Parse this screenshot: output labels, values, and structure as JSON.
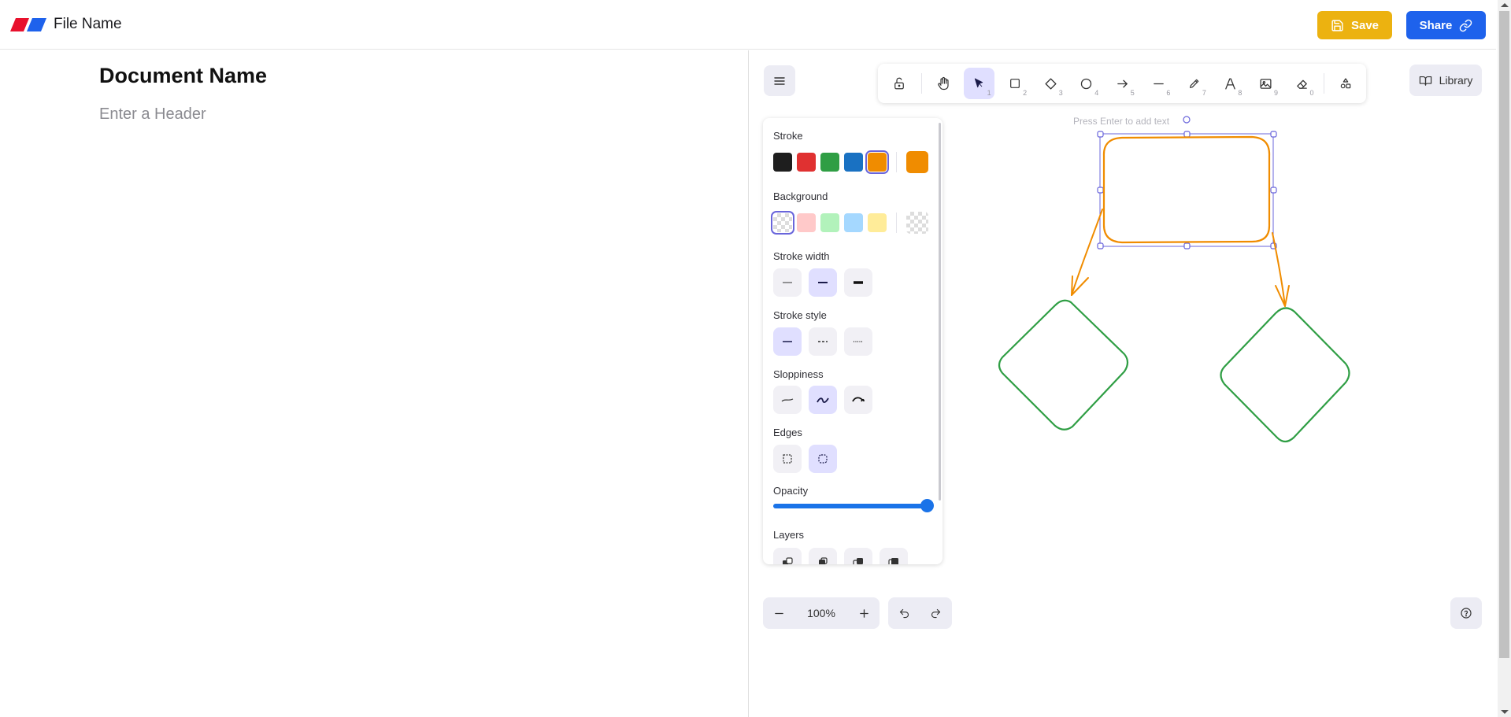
{
  "header": {
    "file_name": "File Name",
    "save_label": "Save",
    "share_label": "Share",
    "brand_colors": [
      "#e8112d",
      "#1e62ec"
    ],
    "save_color": "#ecb210",
    "share_color": "#1e62ec"
  },
  "document": {
    "title": "Document Name",
    "header_placeholder": "Enter a Header"
  },
  "canvas": {
    "toolbar": {
      "tools": [
        {
          "name": "lock",
          "key": ""
        },
        {
          "name": "hand",
          "key": ""
        },
        {
          "name": "selection",
          "key": "1",
          "active": true
        },
        {
          "name": "rectangle",
          "key": "2"
        },
        {
          "name": "diamond",
          "key": "3"
        },
        {
          "name": "ellipse",
          "key": "4"
        },
        {
          "name": "arrow",
          "key": "5"
        },
        {
          "name": "line",
          "key": "6"
        },
        {
          "name": "draw",
          "key": "7"
        },
        {
          "name": "text",
          "key": "8"
        },
        {
          "name": "image",
          "key": "9"
        },
        {
          "name": "eraser",
          "key": "0"
        },
        {
          "name": "shapes",
          "key": ""
        }
      ]
    },
    "library_label": "Library",
    "hint_text": "Press Enter to add text",
    "zoom_label": "100%",
    "properties": {
      "stroke_label": "Stroke",
      "stroke_colors": [
        "#1e1e1e",
        "#e03131",
        "#2f9e44",
        "#1971c2",
        "#f08c00"
      ],
      "stroke_selected": "#f08c00",
      "background_label": "Background",
      "background_colors": [
        "transparent",
        "#ffc9c9",
        "#b2f2bb",
        "#a5d8ff",
        "#ffec99"
      ],
      "stroke_width_label": "Stroke width",
      "stroke_style_label": "Stroke style",
      "sloppiness_label": "Sloppiness",
      "edges_label": "Edges",
      "opacity_label": "Opacity",
      "opacity_value": 100,
      "layers_label": "Layers"
    },
    "accent_color": "#6965db",
    "shape_colors": {
      "rectangle": "#f08c00",
      "diamonds": "#2f9e44",
      "arrows": "#f08c00"
    }
  }
}
